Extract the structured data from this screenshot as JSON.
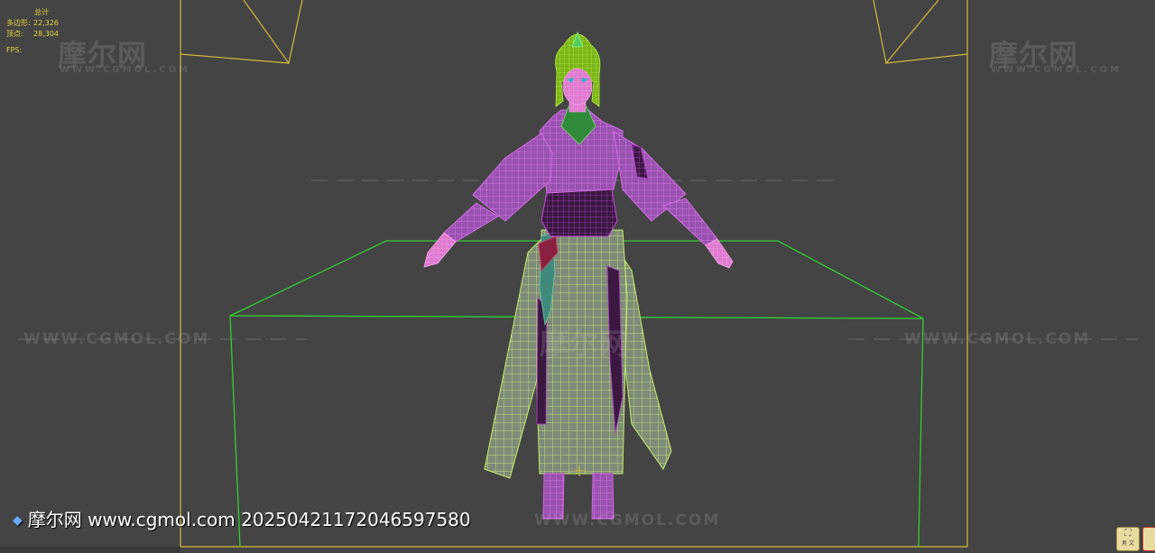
{
  "viewport": {
    "stats": {
      "header": "总计",
      "polygons_label": "多边形:",
      "polygons_value": "22,326",
      "vertices_label": "顶点:",
      "vertices_value": "28,304",
      "fps_label": "FPS:"
    },
    "watermark": {
      "logo": "摩尔网",
      "logo_sub": "WWW.CGMOL.COM",
      "url": "WWW.CGMOL.COM"
    },
    "stamp": "摩尔网 www.cgmol.com 20250421172046597580",
    "nav_cube_label": "男 文"
  },
  "colors": {
    "background": "#444444",
    "safe_frame": "#d4b93a",
    "bounding_box": "#33cc33",
    "wire_body": "#c24fd6",
    "wire_skirt": "#c6f06a",
    "wire_hair": "#9be020",
    "stats_text": "#e8d43a"
  }
}
